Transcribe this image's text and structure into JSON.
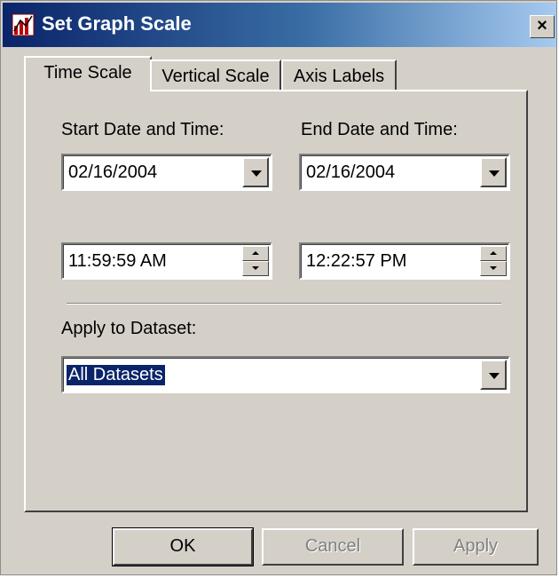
{
  "window": {
    "title": "Set Graph Scale",
    "close_glyph": "×",
    "icon": "graph-app-icon"
  },
  "tabs": [
    {
      "label": "Time Scale",
      "active": true
    },
    {
      "label": "Vertical Scale",
      "active": false
    },
    {
      "label": "Axis Labels",
      "active": false
    }
  ],
  "time_scale": {
    "start_label": "Start Date and Time:",
    "end_label": "End Date and Time:",
    "start_date": "02/16/2004",
    "end_date": "02/16/2004",
    "start_time": "11:59:59 AM",
    "end_time": "12:22:57 PM",
    "dataset_label": "Apply to Dataset:",
    "dataset_value": "All Datasets"
  },
  "buttons": {
    "ok": "OK",
    "cancel": "Cancel",
    "apply": "Apply"
  },
  "colors": {
    "titlebar_start": "#0a246a",
    "titlebar_end": "#a6caf0",
    "dialog_face": "#d4d0c8",
    "selection": "#0a246a"
  }
}
